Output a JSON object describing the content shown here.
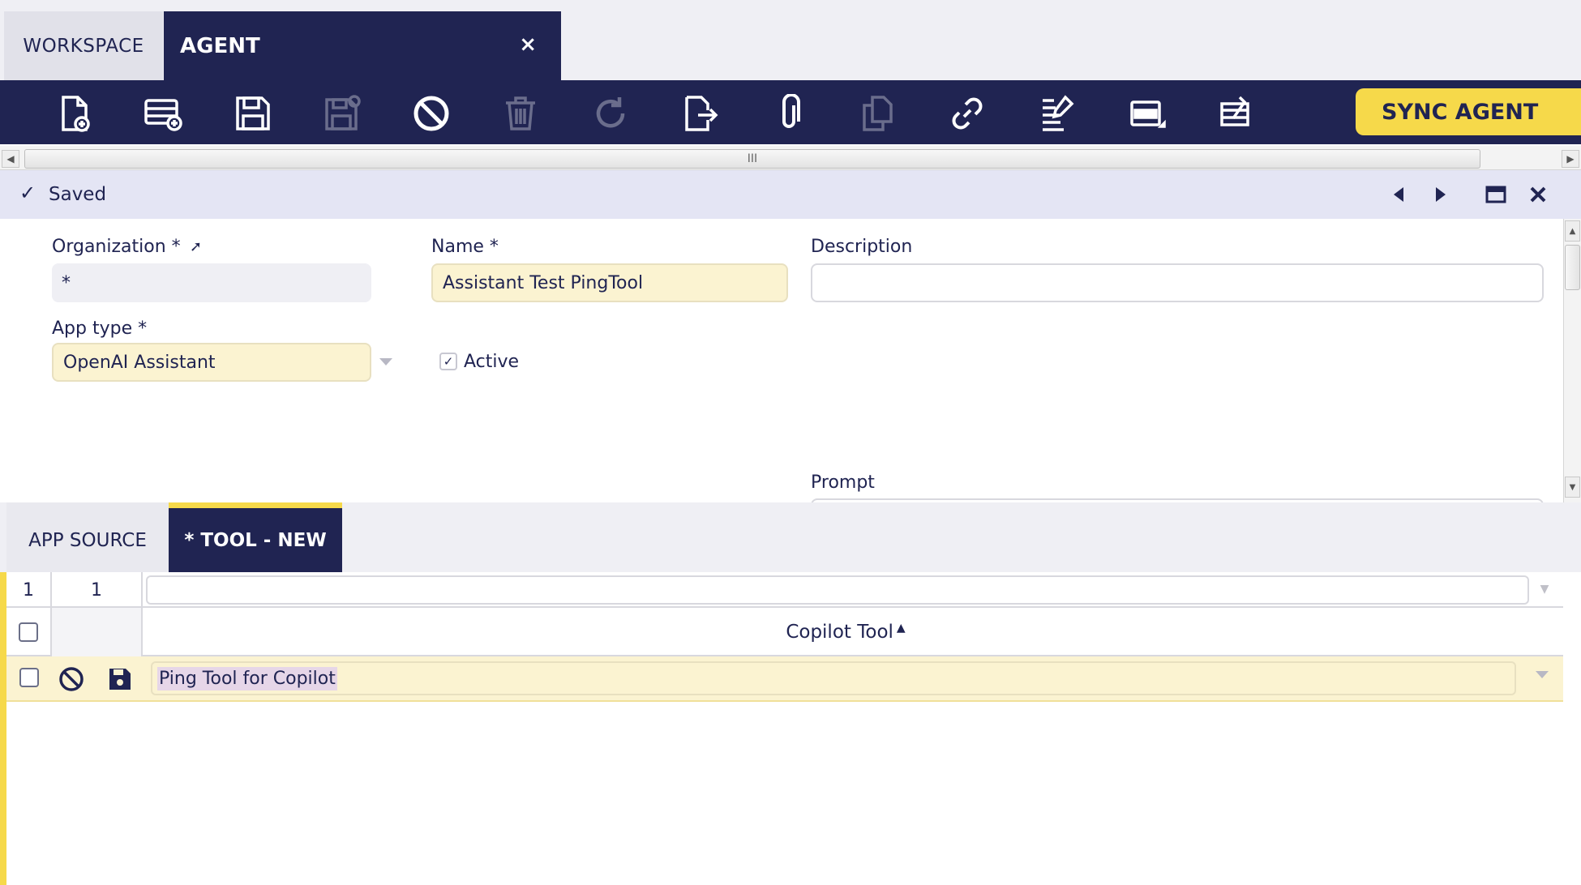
{
  "tabs": {
    "workspace": "WORKSPACE",
    "agent": "AGENT",
    "close": "×"
  },
  "toolbar": {
    "icons": [
      "new-document-icon",
      "new-row-icon",
      "save-icon",
      "save-close-icon",
      "undo-icon",
      "delete-icon",
      "refresh-icon",
      "export-icon",
      "attachment-icon",
      "copy-icon",
      "link-icon",
      "audit-icon",
      "form-view-icon",
      "edit-grid-icon"
    ],
    "sync_label": "SYNC AGENT"
  },
  "status": {
    "text": "Saved"
  },
  "form": {
    "organization": {
      "label": "Organization *",
      "value": "*"
    },
    "name": {
      "label": "Name *",
      "value": "Assistant Test PingTool"
    },
    "description": {
      "label": "Description",
      "value": ""
    },
    "app_type": {
      "label": "App type *",
      "value": "OpenAI Assistant"
    },
    "active": {
      "label": "Active",
      "checked": true
    },
    "prompt": {
      "label": "Prompt"
    }
  },
  "subtabs": {
    "app_source": "APP SOURCE",
    "tool_new": "* TOOL - NEW"
  },
  "grid": {
    "count_a": "1",
    "count_b": "1",
    "column_header": "Copilot Tool",
    "sort_indicator": "▲",
    "rows": [
      {
        "value": "Ping Tool for Copilot"
      }
    ]
  },
  "colors": {
    "navy": "#202452",
    "accent_yellow": "#f6d94a",
    "required_bg": "#fbf3d1",
    "status_bg": "#e4e5f4"
  }
}
